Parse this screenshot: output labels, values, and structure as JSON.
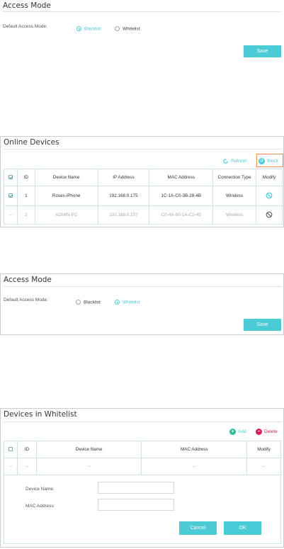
{
  "access_mode_1": {
    "title": "Access Mode",
    "default_label": "Default Access Mode:",
    "options": [
      "Blacklist",
      "Whitelist"
    ],
    "selected": "Blacklist",
    "save_label": "Save"
  },
  "online_devices": {
    "title": "Online Devices",
    "refresh_label": "Refresh",
    "block_label": "Block",
    "columns": [
      "ID",
      "Device Name",
      "IP Address",
      "MAC Address",
      "Connection Type",
      "Modify"
    ],
    "rows": [
      {
        "checked": true,
        "id": "1",
        "name": "Roses-iPhone",
        "ip": "192.168.0.175",
        "mac": "1C-1A-C0-3B-28-4B",
        "type": "Wireless",
        "muted": false
      },
      {
        "checked": false,
        "id": "2",
        "name": "ADMIN-PC",
        "ip": "192.168.0.157",
        "mac": "C0-4A-00-1A-C3-45",
        "type": "Wireless",
        "muted": true
      }
    ],
    "colors": {
      "accent": "#4acbd6",
      "highlight_border": "#f0904a"
    }
  },
  "access_mode_2": {
    "title": "Access Mode",
    "default_label": "Default Access Mode:",
    "options": [
      "Blacklist",
      "Whitelist"
    ],
    "selected": "Whitelist",
    "save_label": "Save"
  },
  "whitelist": {
    "title": "Devices in Whitelist",
    "add_label": "Add",
    "delete_label": "Delete",
    "columns": [
      "ID",
      "Device Name",
      "MAC Address",
      "Modify"
    ],
    "placeholder_row": [
      "--",
      "--",
      "--",
      "--",
      "--"
    ],
    "form": {
      "device_name_label": "Device Name:",
      "mac_address_label": "MAC Address:",
      "device_name_value": "",
      "mac_address_value": ""
    },
    "cancel_label": "Cancel",
    "ok_label": "OK",
    "colors": {
      "add": "#2ebf9a",
      "delete": "#d81b60"
    }
  }
}
